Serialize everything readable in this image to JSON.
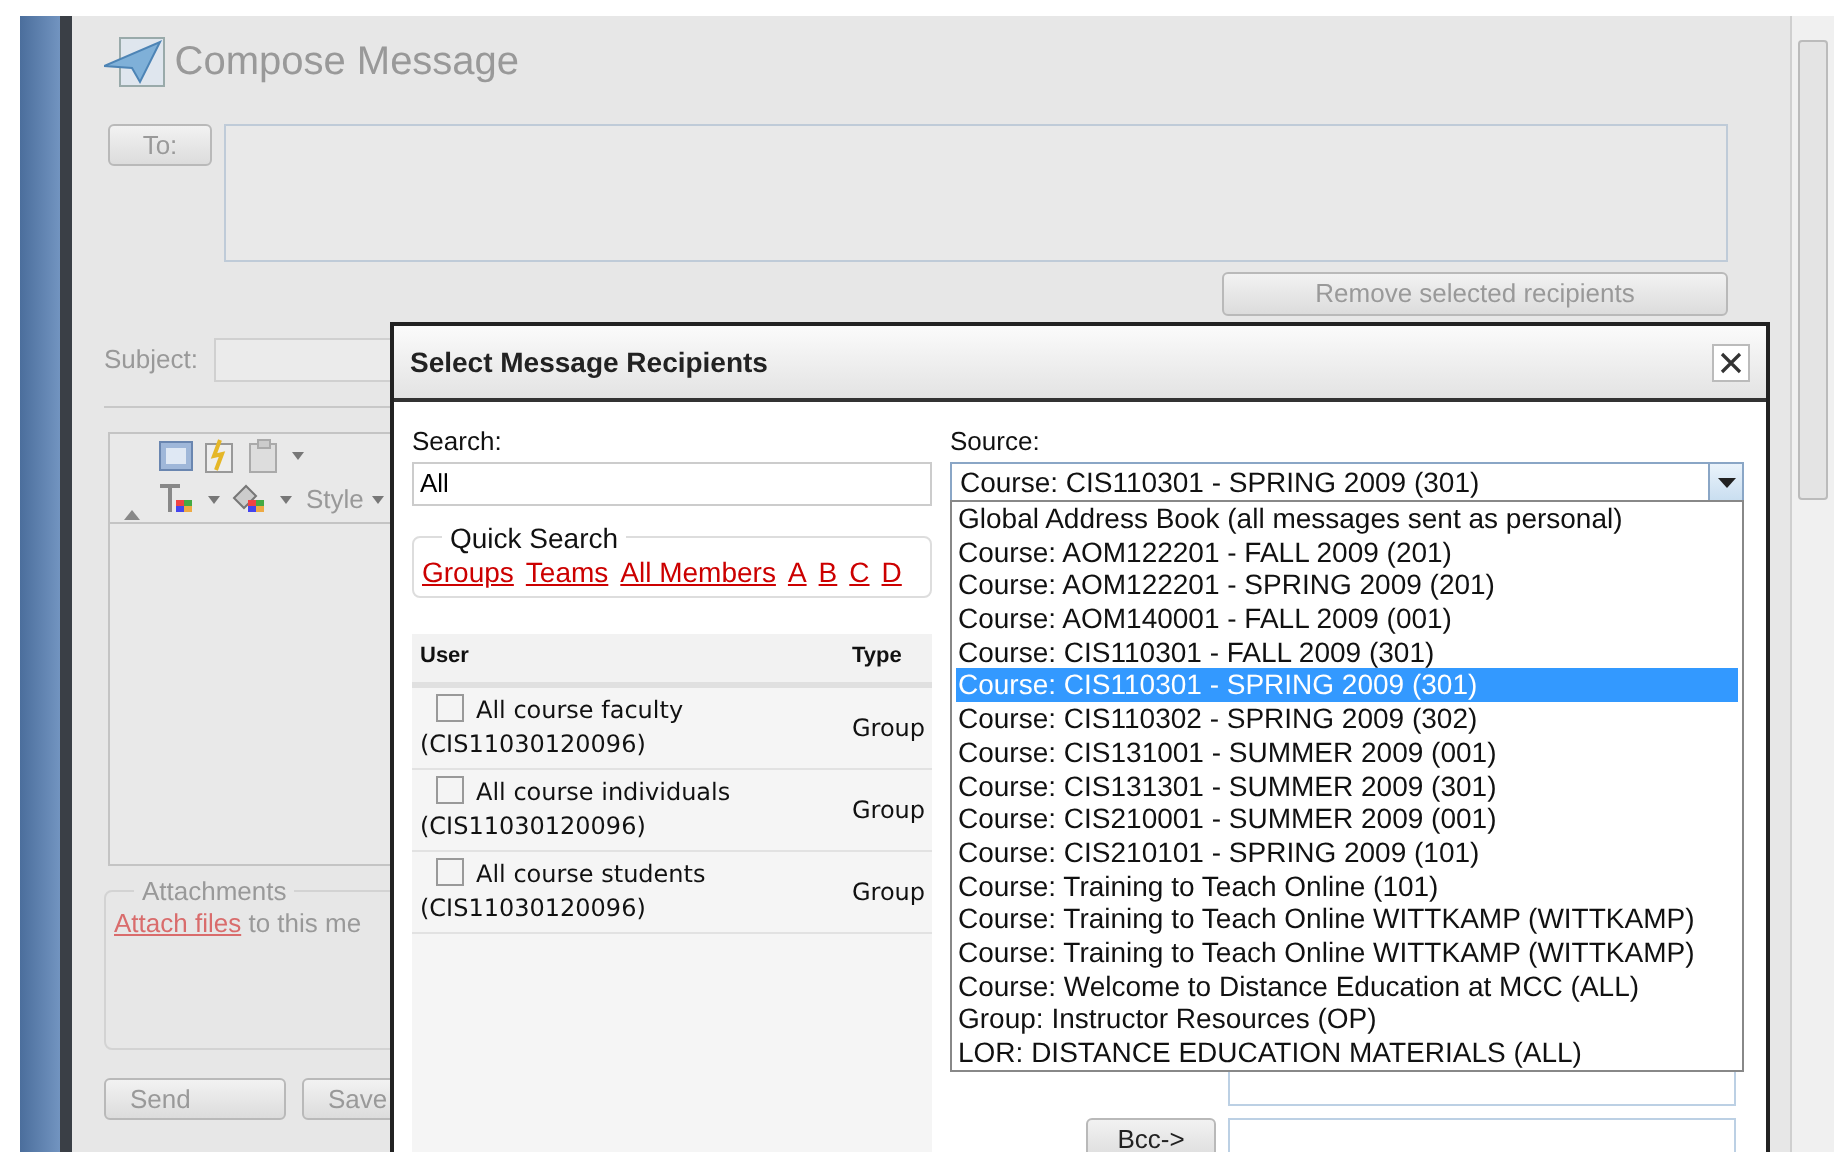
{
  "compose": {
    "title": "Compose Message",
    "to_button": "To:",
    "remove_button": "Remove selected recipients",
    "subject_label": "Subject:",
    "style_label": "Style",
    "attachments": {
      "legend": "Attachments",
      "link": "Attach files",
      "text": "to this me"
    },
    "buttons": [
      "Send",
      "Save"
    ]
  },
  "dialog": {
    "title": "Select Message Recipients",
    "search": {
      "label": "Search:",
      "value": "All"
    },
    "source": {
      "label": "Source:",
      "value": "Course: CIS110301 - SPRING 2009 (301)",
      "expanded": true,
      "options": [
        {
          "label": "Global Address Book (all messages sent as personal)",
          "selected": false
        },
        {
          "label": "Course: AOM122201 - FALL 2009 (201)",
          "selected": false
        },
        {
          "label": "Course: AOM122201 - SPRING 2009 (201)",
          "selected": false
        },
        {
          "label": "Course: AOM140001 - FALL 2009 (001)",
          "selected": false
        },
        {
          "label": "Course: CIS110301 - FALL 2009 (301)",
          "selected": false
        },
        {
          "label": "Course: CIS110301 - SPRING 2009 (301)",
          "selected": true
        },
        {
          "label": "Course: CIS110302 - SPRING 2009 (302)",
          "selected": false
        },
        {
          "label": "Course: CIS131001 - SUMMER 2009 (001)",
          "selected": false
        },
        {
          "label": "Course: CIS131301 - SUMMER 2009 (301)",
          "selected": false
        },
        {
          "label": "Course: CIS210001 - SUMMER 2009 (001)",
          "selected": false
        },
        {
          "label": "Course: CIS210101 - SPRING 2009 (101)",
          "selected": false
        },
        {
          "label": "Course: Training to Teach Online (101)",
          "selected": false
        },
        {
          "label": "Course: Training to Teach Online WITTKAMP (WITTKAMP)",
          "selected": false
        },
        {
          "label": "Course: Training to Teach Online WITTKAMP (WITTKAMP)",
          "selected": false
        },
        {
          "label": "Course: Welcome to Distance Education at MCC (ALL)",
          "selected": false
        },
        {
          "label": "Group: Instructor Resources (OP)",
          "selected": false
        },
        {
          "label": "LOR: DISTANCE EDUCATION MATERIALS (ALL)",
          "selected": false
        }
      ]
    },
    "quick_search": {
      "legend": "Quick Search",
      "links": [
        "Groups",
        "Teams",
        "All Members",
        "A",
        "B",
        "C",
        "D"
      ]
    },
    "table": {
      "columns": [
        "User",
        "Type"
      ],
      "rows": [
        {
          "name": "All course faculty",
          "code": "(CIS11030120096)",
          "type": "Group",
          "checked": false
        },
        {
          "name": "All course individuals",
          "code": "(CIS11030120096)",
          "type": "Group",
          "checked": false
        },
        {
          "name": "All course students",
          "code": "(CIS11030120096)",
          "type": "Group",
          "checked": false
        }
      ]
    },
    "bcc_button": "Bcc->"
  }
}
